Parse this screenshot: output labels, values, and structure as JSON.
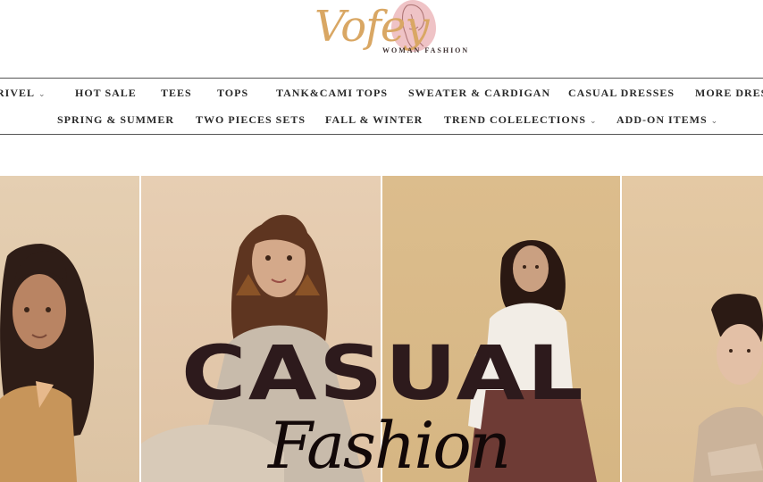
{
  "brand": {
    "name": "Vofey",
    "tagline": "WOMAN  FASHION"
  },
  "nav": {
    "row1": [
      {
        "label": "RIVEL",
        "has_dropdown": true
      },
      {
        "label": "HOT SALE",
        "has_dropdown": false
      },
      {
        "label": "TEES",
        "has_dropdown": false
      },
      {
        "label": "TOPS",
        "has_dropdown": false
      },
      {
        "label": "TANK&CAMI TOPS",
        "has_dropdown": false
      },
      {
        "label": "SWEATER & CARDIGAN",
        "has_dropdown": false
      },
      {
        "label": "CASUAL DRESSES",
        "has_dropdown": false
      },
      {
        "label": "MORE DRES",
        "has_dropdown": false
      }
    ],
    "row2": [
      {
        "label": "SPRING & SUMMER",
        "has_dropdown": false
      },
      {
        "label": "TWO PIECES SETS",
        "has_dropdown": false
      },
      {
        "label": "FALL & WINTER",
        "has_dropdown": false
      },
      {
        "label": "TREND COLELECTIONS",
        "has_dropdown": true
      },
      {
        "label": "ADD-ON ITEMS",
        "has_dropdown": true
      }
    ],
    "chevron_glyph": "⌄"
  },
  "hero": {
    "title": "CASUAL",
    "script": "Fashion"
  },
  "colors": {
    "logo_gold": "#d9a764",
    "logo_pink": "#efc3c6",
    "hero_title": "#2d1a1c",
    "nav_text": "#2a2a2a"
  }
}
